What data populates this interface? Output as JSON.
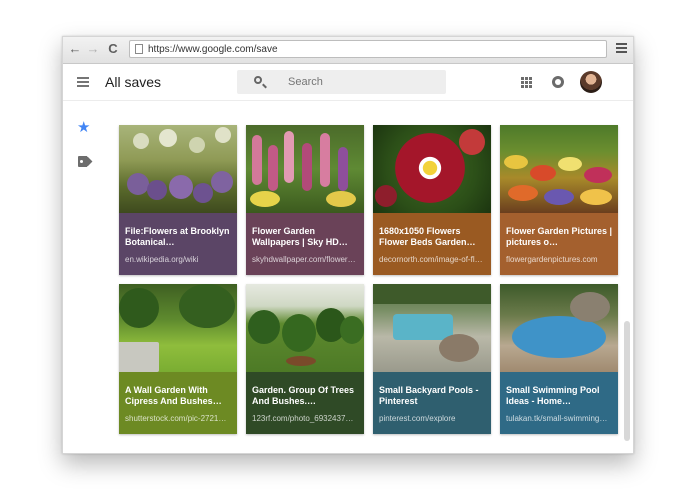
{
  "browser": {
    "url": "https://www.google.com/save",
    "back_icon": "←",
    "forward_icon": "→",
    "reload_icon": "C"
  },
  "app": {
    "title": "All saves",
    "search_placeholder": "Search"
  },
  "sidebar": {
    "items": [
      {
        "name": "starred",
        "icon": "star-icon",
        "color": "#4285f4"
      },
      {
        "name": "tags",
        "icon": "tag-icon",
        "color": "#6d6d6d"
      }
    ]
  },
  "cards": [
    {
      "title": "File:Flowers at Brooklyn Botanical…",
      "source": "en.wikipedia.org/wiki",
      "color": "#5b4566"
    },
    {
      "title": "Flower Garden Wallpapers | Sky HD…",
      "source": "skyhdwallpaper.com/flower…",
      "color": "#6a4258"
    },
    {
      "title": "1680x1050 Flowers Flower Beds Garden…",
      "source": "decornorth.com/image-of-fl…",
      "color": "#9a5a22"
    },
    {
      "title": "Flower Garden Pictures | pictures o…",
      "source": "flowergardenpictures.com",
      "color": "#a4602e"
    },
    {
      "title": "A Wall Garden With Cipress And Bushes…",
      "source": "shutterstock.com/pic-2721…",
      "color": "#6d8a23"
    },
    {
      "title": "Garden. Group Of Trees And Bushes.…",
      "source": "123rf.com/photo_6932437…",
      "color": "#2f4a26"
    },
    {
      "title": "Small Backyard Pools - Pinterest",
      "source": "pinterest.com/explore",
      "color": "#2f5f6f"
    },
    {
      "title": "Small Swimming Pool Ideas - Home…",
      "source": "tulakan.tk/small-swimming…",
      "color": "#2f6a86"
    }
  ]
}
